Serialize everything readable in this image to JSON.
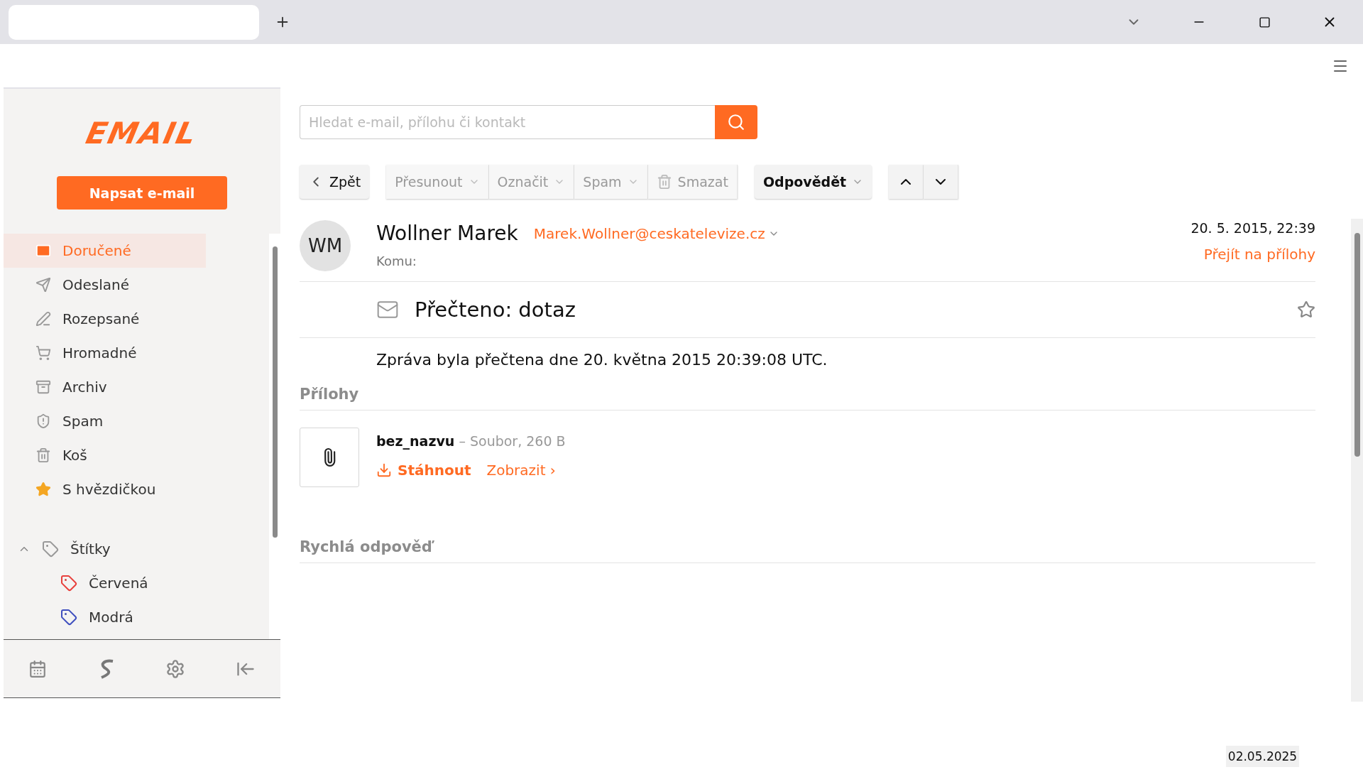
{
  "logo": "EMAIL",
  "compose_button": "Napsat e-mail",
  "folders": [
    {
      "label": "Doručené",
      "selected": true
    },
    {
      "label": "Odeslané",
      "selected": false
    },
    {
      "label": "Rozepsané",
      "selected": false
    },
    {
      "label": "Hromadné",
      "selected": false
    },
    {
      "label": "Archiv",
      "selected": false
    },
    {
      "label": "Spam",
      "selected": false
    },
    {
      "label": "Koš",
      "selected": false
    },
    {
      "label": "S hvězdičkou",
      "selected": false
    }
  ],
  "labels_section": {
    "label": "Štítky",
    "expanded": true,
    "children": [
      {
        "label": "Červená",
        "color": "#e8403c"
      },
      {
        "label": "Modrá",
        "color": "#3f4fbf"
      }
    ]
  },
  "search": {
    "placeholder": "Hledat e-mail, přílohu či kontakt"
  },
  "toolbar": {
    "back": "Zpět",
    "actions": [
      {
        "label": "Přesunout",
        "kind": "dropdown",
        "disabled": true
      },
      {
        "label": "Označit",
        "kind": "dropdown",
        "disabled": true
      },
      {
        "label": "Spam",
        "kind": "dropdown",
        "disabled": true
      },
      {
        "label": "Smazat",
        "kind": "delete",
        "disabled": true
      }
    ],
    "reply": "Odpovědět"
  },
  "message": {
    "avatar": "WM",
    "sender": "Wollner Marek",
    "email": "Marek.Wollner@ceskatelevize.cz",
    "to_label": "Komu:",
    "date": "20. 5. 2015, 22:39",
    "attachments_link": "Přejít na přílohy",
    "subject": "Přečteno: dotaz",
    "starred": false,
    "body": "Zpráva byla přečtena dne 20. května 2015 20:39:08 UTC."
  },
  "attachments": {
    "heading": "Přílohy",
    "items": [
      {
        "name": "bez_nazvu",
        "meta": "– Soubor, 260 B",
        "download": "Stáhnout",
        "view": "Zobrazit ›"
      }
    ]
  },
  "quick_reply": {
    "heading": "Rychlá odpověď"
  },
  "date_stamp": "02.05.2025"
}
